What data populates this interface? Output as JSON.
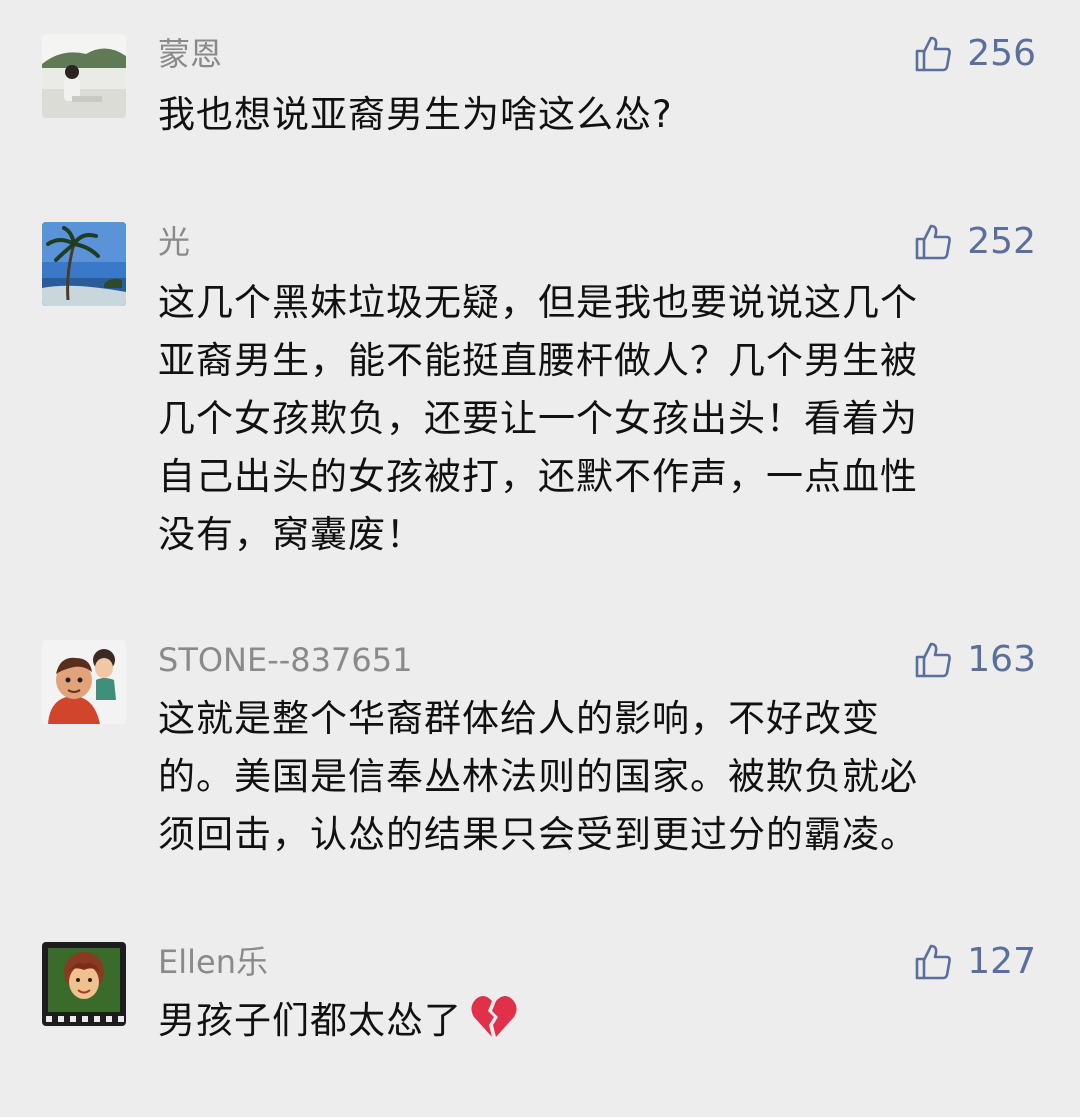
{
  "comments": [
    {
      "user": "蒙恩",
      "likes": "256",
      "lines": [
        "我也想说亚裔男生为啥这么怂?"
      ]
    },
    {
      "user": "光",
      "likes": "252",
      "lines": [
        "这几个黑妹垃圾无疑，但是我也要说说这几个",
        "亚裔男生，能不能挺直腰杆做人？几个男生被",
        "几个女孩欺负，还要让一个女孩出头！看着为",
        "自己出头的女孩被打，还默不作声，一点血性",
        "没有，窝囊废！"
      ]
    },
    {
      "user": "STONE--837651",
      "likes": "163",
      "lines": [
        "这就是整个华裔群体给人的影响，不好改变",
        "的。美国是信奉丛林法则的国家。被欺负就必",
        "须回击，认怂的结果只会受到更过分的霸凌。"
      ]
    },
    {
      "user": "Ellen乐",
      "likes": "127",
      "lines": [
        "男孩子们都太怂了"
      ],
      "trailing_emoji": "broken-heart-icon"
    }
  ],
  "colors": {
    "background": "#ededed",
    "username": "#8a8a8a",
    "like_accent": "#5a6f9b",
    "text": "#111111",
    "heart": "#e0304a"
  }
}
